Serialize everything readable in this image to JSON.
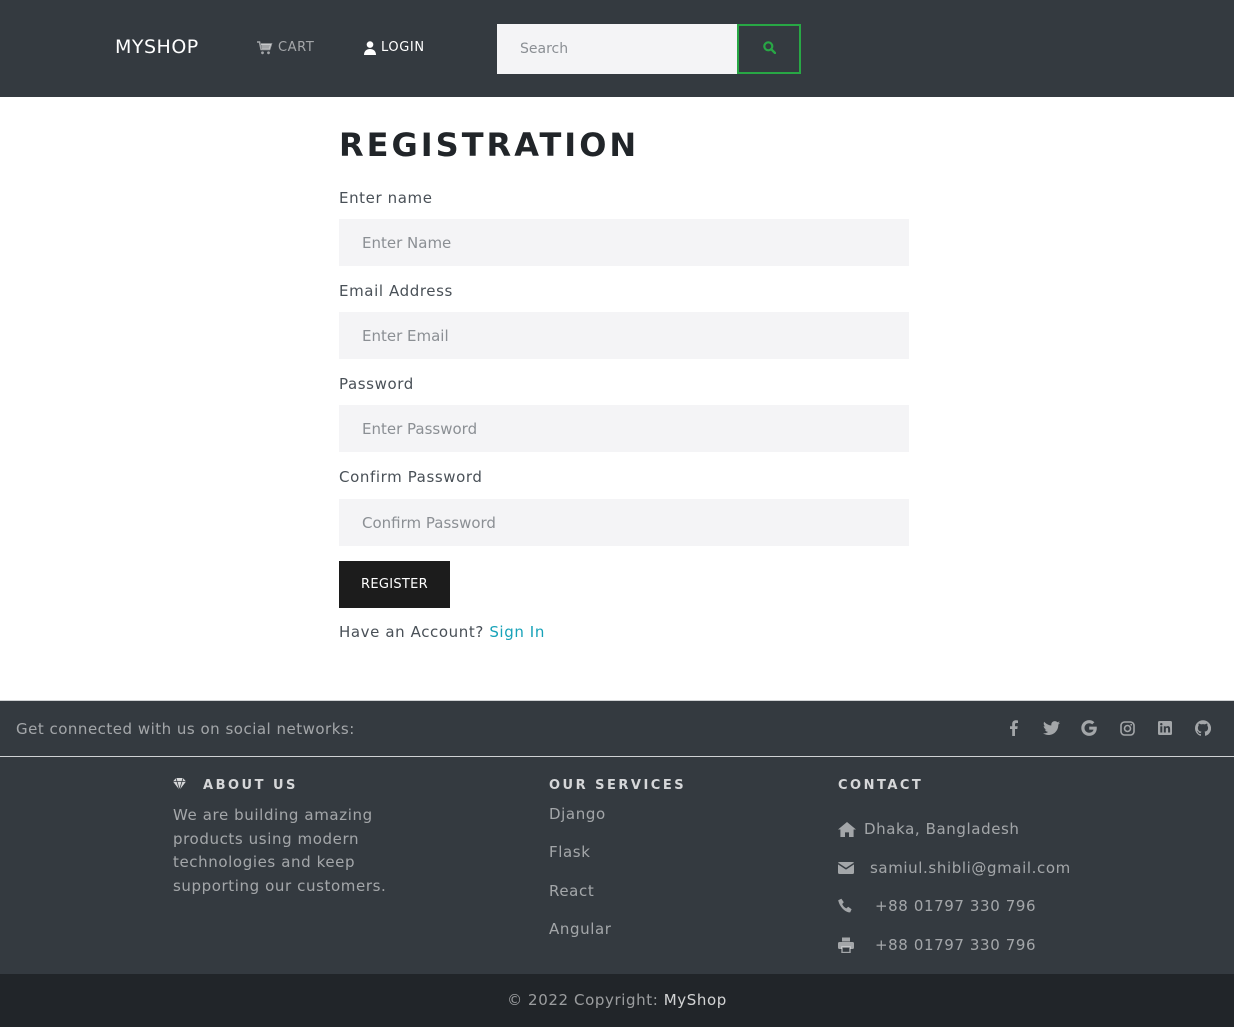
{
  "navbar": {
    "brand": "MYSHOP",
    "cart_label": "CART",
    "login_label": "LOGIN",
    "search_placeholder": "Search",
    "search_icon": "search-icon",
    "accent_color": "#28a745"
  },
  "form": {
    "title": "REGISTRATION",
    "fields": [
      {
        "label": "Enter name",
        "placeholder": "Enter Name"
      },
      {
        "label": "Email Address",
        "placeholder": "Enter Email"
      },
      {
        "label": "Password",
        "placeholder": "Enter Password"
      },
      {
        "label": "Confirm Password",
        "placeholder": "Confirm Password"
      }
    ],
    "submit_label": "REGISTER",
    "have_account_text": "Have an Account?",
    "signin_label": "Sign In"
  },
  "footer": {
    "social_text": "Get connected with us on social networks:",
    "social_icons": [
      "facebook-icon",
      "twitter-icon",
      "google-icon",
      "instagram-icon",
      "linkedin-icon",
      "github-icon"
    ],
    "about": {
      "title": "ABOUT US",
      "text": "We are building amazing products using modern technologies and keep supporting our customers."
    },
    "services": {
      "title": "OUR SERVICES",
      "items": [
        "Django",
        "Flask",
        "React",
        "Angular"
      ]
    },
    "contact": {
      "title": "CONTACT",
      "address": "Dhaka, Bangladesh",
      "email": "samiul.shibli@gmail.com",
      "phone": "+88 01797 330 796",
      "fax": "+88 01797 330 796"
    },
    "copyright_prefix": "© 2022 Copyright:",
    "copyright_link": "MyShop"
  }
}
